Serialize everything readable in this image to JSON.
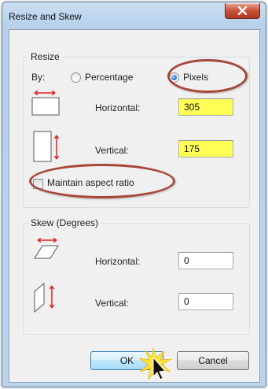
{
  "window": {
    "title": "Resize and Skew",
    "close_icon": "close-icon"
  },
  "resize": {
    "group_title": "Resize",
    "by_label": "By:",
    "percentage_label": "Percentage",
    "pixels_label": "Pixels",
    "selected_mode": "Pixels",
    "horizontal_label": "Horizontal:",
    "horizontal_value": "305",
    "vertical_label": "Vertical:",
    "vertical_value": "175",
    "maintain_aspect_label": "Maintain aspect ratio",
    "maintain_aspect_checked": false,
    "highlight_color": "#ffff55"
  },
  "skew": {
    "group_title": "Skew (Degrees)",
    "horizontal_label": "Horizontal:",
    "horizontal_value": "0",
    "vertical_label": "Vertical:",
    "vertical_value": "0"
  },
  "buttons": {
    "ok_label": "OK",
    "cancel_label": "Cancel"
  },
  "annotations": {
    "callout_color": "#a7473a"
  }
}
